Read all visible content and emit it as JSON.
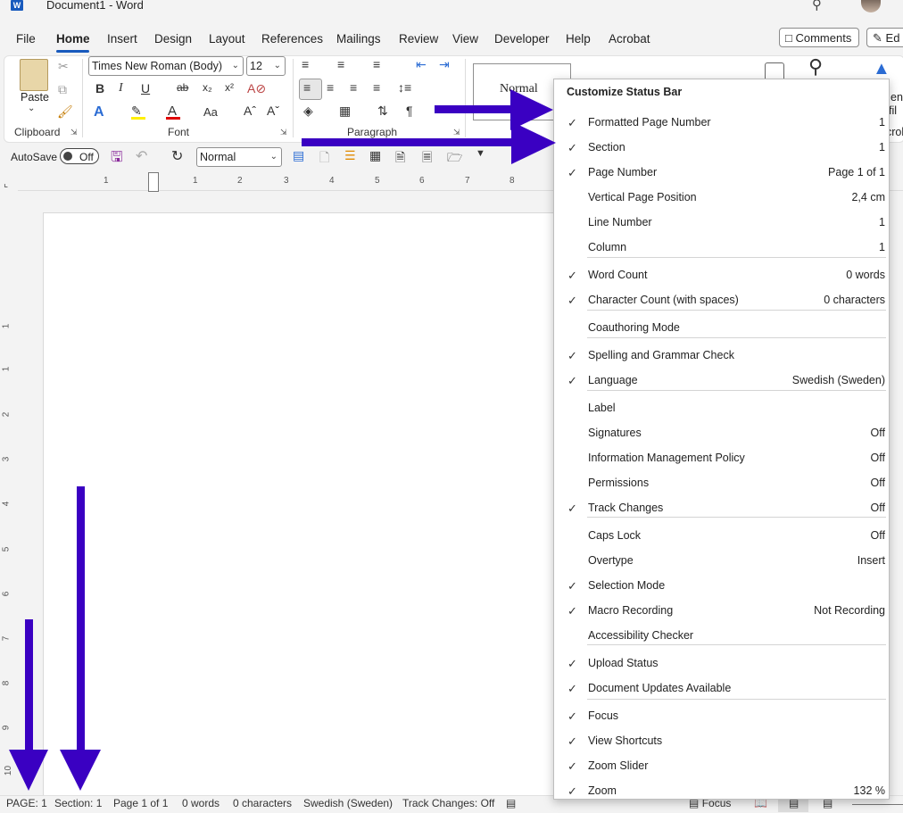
{
  "title_bar": {
    "doc_title": "Document1  -  Word",
    "app_icon_letter": "W"
  },
  "menu": {
    "tabs": [
      "File",
      "Home",
      "Insert",
      "Design",
      "Layout",
      "References",
      "Mailings",
      "Review",
      "View",
      "Developer",
      "Help",
      "Acrobat"
    ],
    "active": "Home",
    "comments_label": "Comments",
    "edit_label": "Ed"
  },
  "ribbon": {
    "paste_label": "Paste",
    "font_name": "Times New Roman (Body)",
    "font_size": "12",
    "groups": {
      "clipboard": "Clipboard",
      "font": "Font",
      "paragraph": "Paragraph"
    },
    "style_preview": "Normal",
    "acrobat_partial_1": "en",
    "acrobat_partial_2": "fil",
    "acrobat_partial_3": "crob"
  },
  "qat": {
    "autosave_label": "AutoSave",
    "autosave_state": "Off",
    "style_value": "Normal"
  },
  "ruler": {
    "h_numbers": [
      "1",
      "1",
      "2",
      "3",
      "4",
      "5",
      "6",
      "7",
      "8"
    ],
    "v_numbers": [
      "1",
      "1",
      "2",
      "3",
      "4",
      "5",
      "6",
      "7",
      "8",
      "9",
      "10"
    ]
  },
  "popup": {
    "title": "Customize Status Bar",
    "items": [
      {
        "label": "Formatted Page Number",
        "value": "1",
        "checked": true
      },
      {
        "label": "Section",
        "value": "1",
        "checked": true
      },
      {
        "label": "Page Number",
        "value": "Page 1 of 1",
        "checked": true
      },
      {
        "label": "Vertical Page Position",
        "value": "2,4 cm",
        "checked": false
      },
      {
        "label": "Line Number",
        "value": "1",
        "checked": false
      },
      {
        "label": "Column",
        "value": "1",
        "checked": false
      },
      {
        "label": "Word Count",
        "value": "0 words",
        "checked": true
      },
      {
        "label": "Character Count (with spaces)",
        "value": "0 characters",
        "checked": true
      },
      {
        "label": "Coauthoring Mode",
        "value": "",
        "checked": false
      },
      {
        "label": "Spelling and Grammar Check",
        "value": "",
        "checked": true
      },
      {
        "label": "Language",
        "value": "Swedish (Sweden)",
        "checked": true
      },
      {
        "label": "Label",
        "value": "",
        "checked": false
      },
      {
        "label": "Signatures",
        "value": "Off",
        "checked": false
      },
      {
        "label": "Information Management Policy",
        "value": "Off",
        "checked": false
      },
      {
        "label": "Permissions",
        "value": "Off",
        "checked": false
      },
      {
        "label": "Track Changes",
        "value": "Off",
        "checked": true
      },
      {
        "label": "Caps Lock",
        "value": "Off",
        "checked": false
      },
      {
        "label": "Overtype",
        "value": "Insert",
        "checked": false
      },
      {
        "label": "Selection Mode",
        "value": "",
        "checked": true
      },
      {
        "label": "Macro Recording",
        "value": "Not Recording",
        "checked": true
      },
      {
        "label": "Accessibility Checker",
        "value": "",
        "checked": false
      },
      {
        "label": "Upload Status",
        "value": "",
        "checked": true
      },
      {
        "label": "Document Updates Available",
        "value": "",
        "checked": true
      },
      {
        "label": "Focus",
        "value": "",
        "checked": true
      },
      {
        "label": "View Shortcuts",
        "value": "",
        "checked": true
      },
      {
        "label": "Zoom Slider",
        "value": "",
        "checked": true
      },
      {
        "label": "Zoom",
        "value": "132 %",
        "checked": true
      }
    ]
  },
  "status_bar": {
    "page": "PAGE: 1",
    "section": "Section: 1",
    "page_of": "Page 1 of 1",
    "words": "0 words",
    "characters": "0 characters",
    "language": "Swedish (Sweden)",
    "track_changes": "Track Changes: Off",
    "focus": "Focus"
  },
  "annotation_color": "#3a00c2"
}
